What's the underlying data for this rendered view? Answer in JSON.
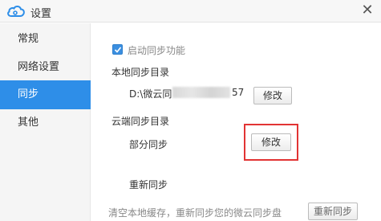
{
  "window": {
    "title": "设置",
    "close_label": "✕"
  },
  "sidebar": {
    "items": [
      {
        "label": "常规"
      },
      {
        "label": "网络设置"
      },
      {
        "label": "同步",
        "active": true
      },
      {
        "label": "其他"
      }
    ]
  },
  "sync": {
    "enable_label": "启动同步功能",
    "enable_checked": true,
    "local_dir_label": "本地同步目录",
    "local_path_prefix": "D:\\微云同",
    "local_path_suffix": "57",
    "modify_label": "修改",
    "cloud_dir_label": "云端同步目录",
    "partial_sync_label": "部分同步",
    "resync_label": "重新同步",
    "resync_desc": "清空本地缓存，重新同步您的微云同步盘",
    "resync_button_label": "重新同步"
  },
  "colors": {
    "accent": "#2e8ee8",
    "highlight": "#e23434"
  }
}
